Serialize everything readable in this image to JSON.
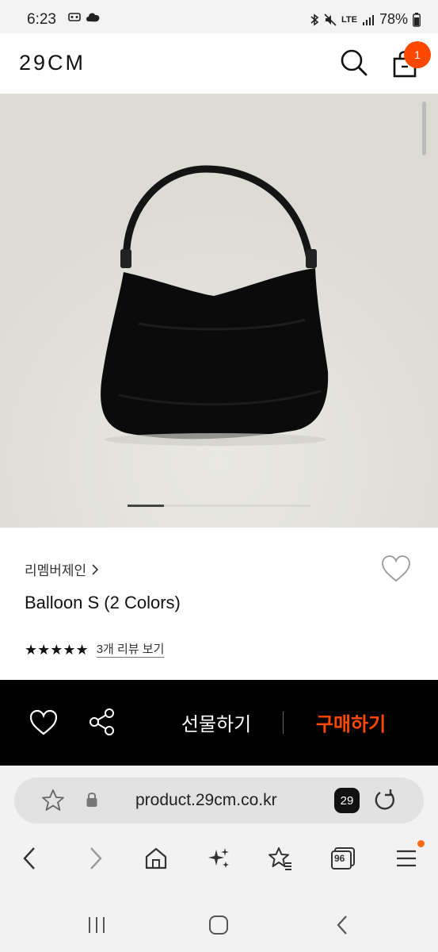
{
  "status_bar": {
    "time": "6:23",
    "network": "LTE",
    "battery": "78%",
    "icons": [
      "voicemail-icon",
      "cloud-icon",
      "bluetooth-icon",
      "mute-icon",
      "signal-icon",
      "battery-icon"
    ]
  },
  "header": {
    "logo": "29CM",
    "cart_count": "1",
    "icons": [
      "search-icon",
      "shopping-bag-icon"
    ],
    "badge_color": "#ff4800"
  },
  "gallery": {
    "image_alt": "black balloon shoulder bag",
    "background_color": "#e4e3dd",
    "current_slide_fraction": 0.2
  },
  "product": {
    "brand": "리멤버제인",
    "title": "Balloon S (2 Colors)",
    "rating": 5,
    "rating_display": "★★★★★",
    "review_link": "3개 리뷰 보기"
  },
  "action_bar": {
    "gift_label": "선물하기",
    "buy_label": "구매하기",
    "buy_color": "#ff4800",
    "icons": [
      "heart-icon",
      "share-icon"
    ]
  },
  "browser": {
    "url": "product.29cm.co.kr",
    "tab_count": "29",
    "nav_icons": [
      "back-icon",
      "forward-icon",
      "home-icon",
      "sparkle-icon",
      "bookmark-star-icon",
      "tabs-96-icon",
      "menu-icon"
    ],
    "tabs_label": "96"
  },
  "system_nav": {
    "icons": [
      "recent-apps-icon",
      "home-button-icon",
      "back-button-icon"
    ]
  }
}
